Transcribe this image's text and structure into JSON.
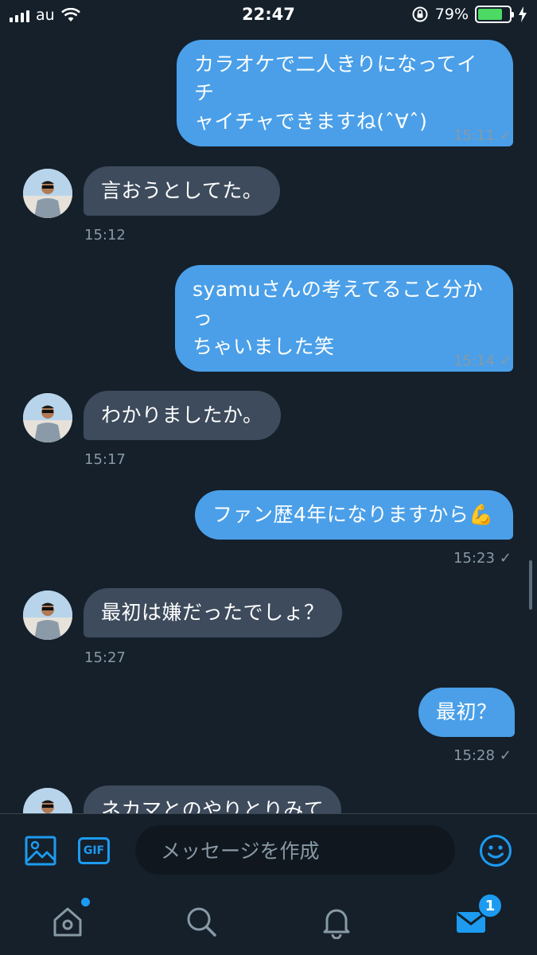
{
  "status_bar": {
    "carrier": "au",
    "time": "22:47",
    "battery_percent": "79%",
    "battery_level": 0.79
  },
  "messages": [
    {
      "direction": "out",
      "text": "カラオケで二人きりになってイチャイチャできますね(*ˊᗜˋ*)",
      "lines": [
        "カラオケで二人きりになってイチ",
        "ャイチャできますね(ˆ∀ˆ)"
      ],
      "time": "15:11",
      "check": "✓"
    },
    {
      "direction": "in",
      "lines": [
        "言おうとしてた。"
      ],
      "time": "15:12"
    },
    {
      "direction": "out",
      "lines": [
        "syamuさんの考えてること分かっ",
        "ちゃいました笑"
      ],
      "time": "15:14",
      "check": "✓"
    },
    {
      "direction": "in",
      "lines": [
        "わかりましたか。"
      ],
      "time": "15:17"
    },
    {
      "direction": "out",
      "lines": [
        "ファン歴4年になりますから💪"
      ],
      "time": "15:23",
      "check": "✓"
    },
    {
      "direction": "in",
      "lines": [
        "最初は嫌だったでしょ？"
      ],
      "time": "15:27"
    },
    {
      "direction": "out",
      "lines": [
        "最初？"
      ],
      "time": "15:28",
      "check": "✓"
    },
    {
      "direction": "in",
      "lines": [
        "ネカマとのやりとりみて"
      ],
      "time": ""
    }
  ],
  "composer": {
    "placeholder": "メッセージを作成",
    "gif_label": "GIF"
  },
  "tabbar": {
    "messages_badge": "1"
  },
  "colors": {
    "background": "#15202b",
    "outgoing_bubble": "#4a9fe8",
    "incoming_bubble": "#3d4b5c",
    "accent": "#1d9bf0",
    "muted_text": "#8899a6"
  }
}
